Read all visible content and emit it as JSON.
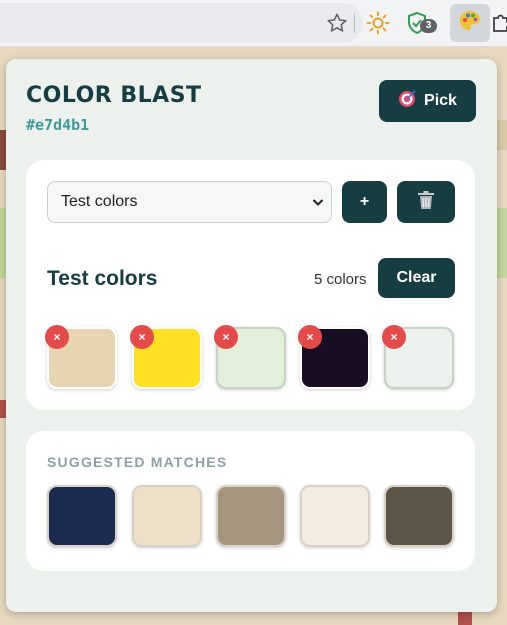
{
  "browser": {
    "icons": [
      "star-icon",
      "sun-icon",
      "shield-check-icon",
      "color-blast-extension-icon",
      "puzzle-icon"
    ],
    "shield_badge": "3"
  },
  "popup": {
    "title": "COLOR BLAST",
    "current_color": "#e7d4b1",
    "pick_button": {
      "icon": "target-icon",
      "label": "Pick"
    }
  },
  "palette": {
    "selected_palette": "Test colors",
    "add_button": "+",
    "delete_button_icon": "trash-icon",
    "name": "Test colors",
    "count_label": "5 colors",
    "clear_button": "Clear",
    "remove_glyph": "×",
    "colors": [
      "#e7d4b1",
      "#ffe022",
      "#e2efd9",
      "#190d24",
      "#edf1ee"
    ]
  },
  "suggested": {
    "label": "SUGGESTED MATCHES",
    "colors": [
      "#1b2b50",
      "#eee0c8",
      "#a6957e",
      "#f4ece0",
      "#5d5646"
    ]
  },
  "colors": {
    "accent": "#163e42",
    "hex_text": "#3d9b9a",
    "remove": "#e34b4b"
  }
}
